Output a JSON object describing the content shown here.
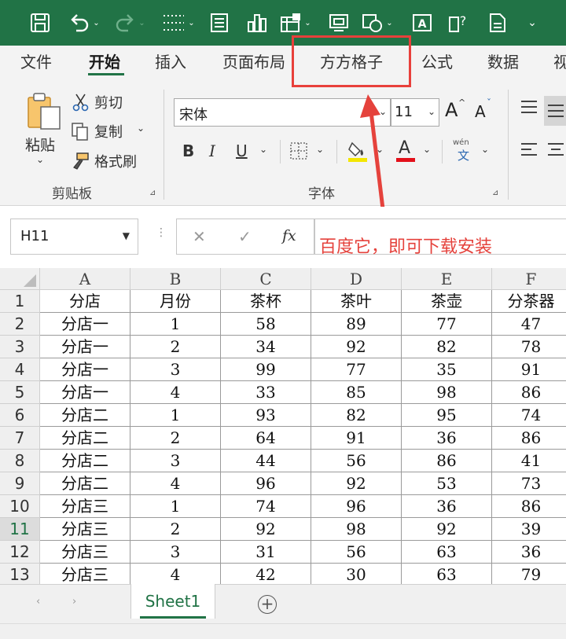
{
  "colors": {
    "accent": "#217346",
    "annotation": "#e5423c"
  },
  "quick_access": {
    "icons": [
      "save-icon",
      "undo-icon",
      "redo-icon",
      "borders-icon",
      "form-icon",
      "chart-icon",
      "table-insert-icon",
      "screenshot-icon",
      "shapes-icon",
      "text-recognition-icon",
      "help-icon",
      "document-icon",
      "customize-icon"
    ]
  },
  "tabs": [
    "文件",
    "开始",
    "插入",
    "页面布局",
    "方方格子",
    "公式",
    "数据",
    "视"
  ],
  "ribbon": {
    "clipboard": {
      "paste": "粘贴",
      "cut": "剪切",
      "copy": "复制",
      "format_painter": "格式刷",
      "group_label": "剪贴板"
    },
    "font": {
      "name": "宋体",
      "size": "11",
      "group_label": "字体",
      "bold": "B",
      "italic": "I",
      "underline": "U",
      "font_color": "A",
      "phonetic": "wén",
      "phonetic_char": "文",
      "grow": "A",
      "shrink": "A"
    }
  },
  "formula_bar": {
    "name_box": "H11",
    "cancel": "✕",
    "enter": "✓",
    "fx": "fx"
  },
  "annotation": {
    "text": "百度它，即可下载安装"
  },
  "sheet": {
    "columns": [
      "A",
      "B",
      "C",
      "D",
      "E",
      "F"
    ],
    "rows": [
      "1",
      "2",
      "3",
      "4",
      "5",
      "6",
      "7",
      "8",
      "9",
      "10",
      "11",
      "12",
      "13"
    ],
    "selected_row": "11",
    "cells": [
      [
        "分店",
        "月份",
        "茶杯",
        "茶叶",
        "茶壶",
        "分茶器"
      ],
      [
        "分店一",
        "1",
        "58",
        "89",
        "77",
        "47"
      ],
      [
        "分店一",
        "2",
        "34",
        "92",
        "82",
        "78"
      ],
      [
        "分店一",
        "3",
        "99",
        "77",
        "35",
        "91"
      ],
      [
        "分店一",
        "4",
        "33",
        "85",
        "98",
        "86"
      ],
      [
        "分店二",
        "1",
        "93",
        "82",
        "95",
        "74"
      ],
      [
        "分店二",
        "2",
        "64",
        "91",
        "36",
        "86"
      ],
      [
        "分店二",
        "3",
        "44",
        "56",
        "86",
        "41"
      ],
      [
        "分店二",
        "4",
        "96",
        "92",
        "53",
        "73"
      ],
      [
        "分店三",
        "1",
        "74",
        "96",
        "36",
        "86"
      ],
      [
        "分店三",
        "2",
        "92",
        "98",
        "92",
        "39"
      ],
      [
        "分店三",
        "3",
        "31",
        "56",
        "63",
        "36"
      ],
      [
        "分店三",
        "4",
        "42",
        "30",
        "63",
        "79"
      ]
    ]
  },
  "sheet_tabs": {
    "active": "Sheet1",
    "add": "+"
  }
}
